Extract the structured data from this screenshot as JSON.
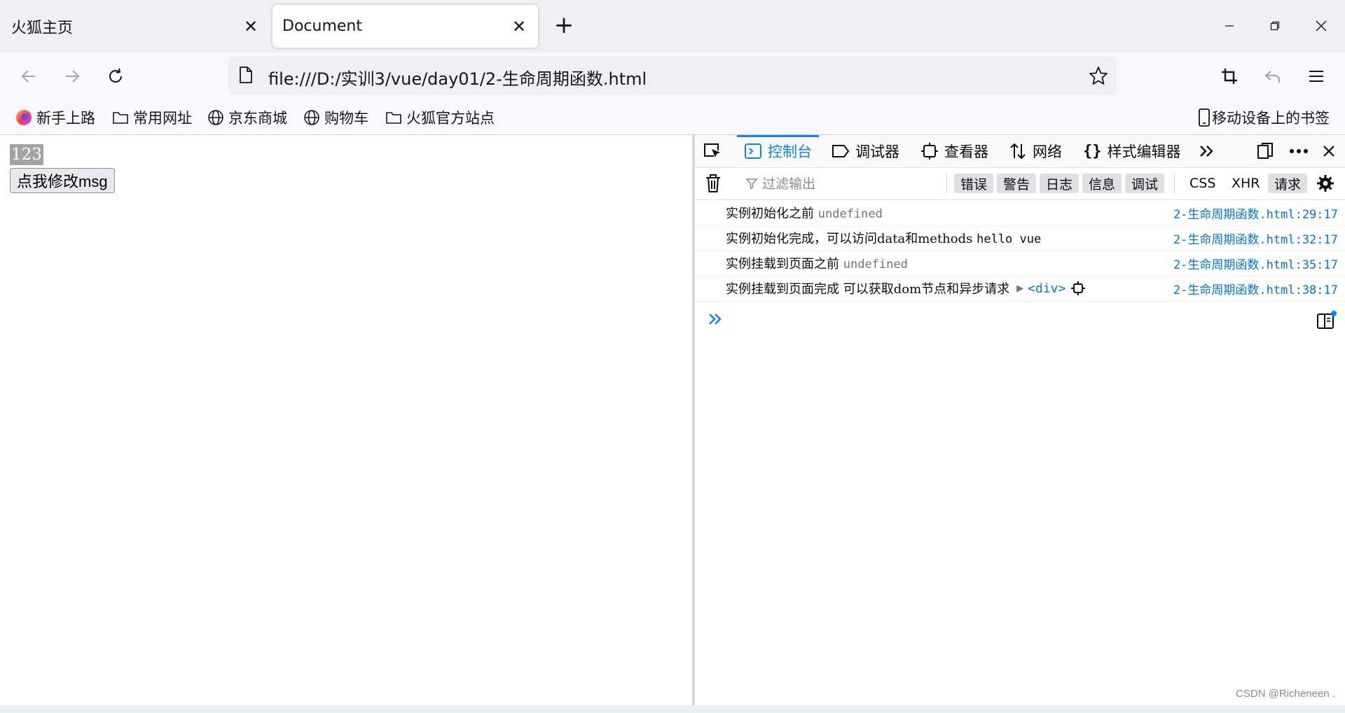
{
  "tabs": [
    {
      "title": "火狐主页",
      "close_icon": "close-icon"
    },
    {
      "title": "Document",
      "close_icon": "close-icon"
    }
  ],
  "new_tab_icon": "plus-icon",
  "window_controls": [
    "minimize-icon",
    "restore-icon",
    "close-icon"
  ],
  "nav": {
    "url": "file:///D:/实训3/vue/day01/2-生命周期函数.html",
    "icons": [
      "back-arrow-icon",
      "forward-arrow-icon",
      "reload-icon",
      "page-icon",
      "star-icon",
      "crop-icon",
      "undo-icon",
      "menu-icon"
    ]
  },
  "bookmarks": [
    {
      "label": "新手上路",
      "icon": "firefox-icon"
    },
    {
      "label": "常用网址",
      "icon": "folder-icon"
    },
    {
      "label": "京东商城",
      "icon": "globe-icon"
    },
    {
      "label": "购物车",
      "icon": "globe-icon"
    },
    {
      "label": "火狐官方站点",
      "icon": "folder-icon"
    }
  ],
  "mobile_bookmarks": "移动设备上的书签",
  "page": {
    "msg": "123",
    "button_label": "点我修改msg"
  },
  "devtools": {
    "tabs": [
      {
        "label": "控制台",
        "icon": "console-icon",
        "selected": true
      },
      {
        "label": "调试器",
        "icon": "debugger-icon",
        "selected": false
      },
      {
        "label": "查看器",
        "icon": "inspector-icon",
        "selected": false
      },
      {
        "label": "网络",
        "icon": "network-icon",
        "selected": false
      },
      {
        "label": "样式编辑器",
        "icon": "style-editor-icon",
        "selected": false
      }
    ],
    "filter_placeholder": "过滤输出",
    "filter_buttons": [
      "错误",
      "警告",
      "日志",
      "信息",
      "调试",
      "CSS",
      "XHR",
      "请求"
    ],
    "active_filters": [
      "错误",
      "警告",
      "日志",
      "信息",
      "调试",
      "请求"
    ],
    "logs": [
      {
        "text": "实例初始化之前",
        "value": "undefined",
        "source": "2-生命周期函数.html:29:17"
      },
      {
        "text": "实例初始化完成，可以访问data和methods",
        "value": "hello vue",
        "source": "2-生命周期函数.html:32:17"
      },
      {
        "text": "实例挂载到页面之前",
        "value": "undefined",
        "source": "2-生命周期函数.html:35:17"
      },
      {
        "text": "实例挂载到页面完成 可以获取dom节点和异步请求",
        "value": "<div>",
        "source": "2-生命周期函数.html:38:17"
      }
    ],
    "accent_color": "#0a84ff"
  },
  "watermark": "CSDN @Richeneen ."
}
